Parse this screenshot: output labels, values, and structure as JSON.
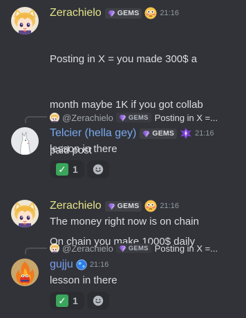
{
  "colors": {
    "background": "#313338",
    "zerachielo_name": "#e5e38a",
    "telcier_name": "#7aa9f0",
    "gujju_name": "#7b9ff2",
    "gem_purple": "#a77be8",
    "reaction_bg": "#2b2d31"
  },
  "messages": [
    {
      "author": "Zerachielo",
      "tag": "GEMS",
      "time": "21:16",
      "lines": [
        "Posting in X = you made 300$ a",
        "month maybe 1K if you got collab",
        "paid post",
        "",
        "On chain you make 1000$ daily"
      ],
      "icons": [
        "gem-icon",
        "flushed-emoji-icon"
      ]
    },
    {
      "reply": {
        "author": "@Zerachielo",
        "tag": "GEMS",
        "text": "Posting in X =..."
      },
      "author": "Telcier (hella gey)",
      "tag": "GEMS",
      "time": "21:16",
      "text": "lesson in there",
      "reactions": [
        {
          "emoji": "check-mark-icon",
          "count": "1"
        }
      ],
      "icons": [
        "gem-icon",
        "purple-crystal-icon",
        "add-reaction-icon"
      ]
    },
    {
      "author": "Zerachielo",
      "tag": "GEMS",
      "time": "21:16",
      "text": "The money right now is on chain",
      "icons": [
        "gem-icon",
        "flushed-emoji-icon"
      ]
    },
    {
      "reply": {
        "author": "@Zerachielo",
        "tag": "GEMS",
        "text": "Posting in X =..."
      },
      "author": "gujju",
      "time": "21:16",
      "text": "lesson in there",
      "reactions": [
        {
          "emoji": "check-mark-icon",
          "count": "1"
        }
      ],
      "icons": [
        "blue-globe-icon",
        "add-reaction-icon"
      ]
    }
  ]
}
